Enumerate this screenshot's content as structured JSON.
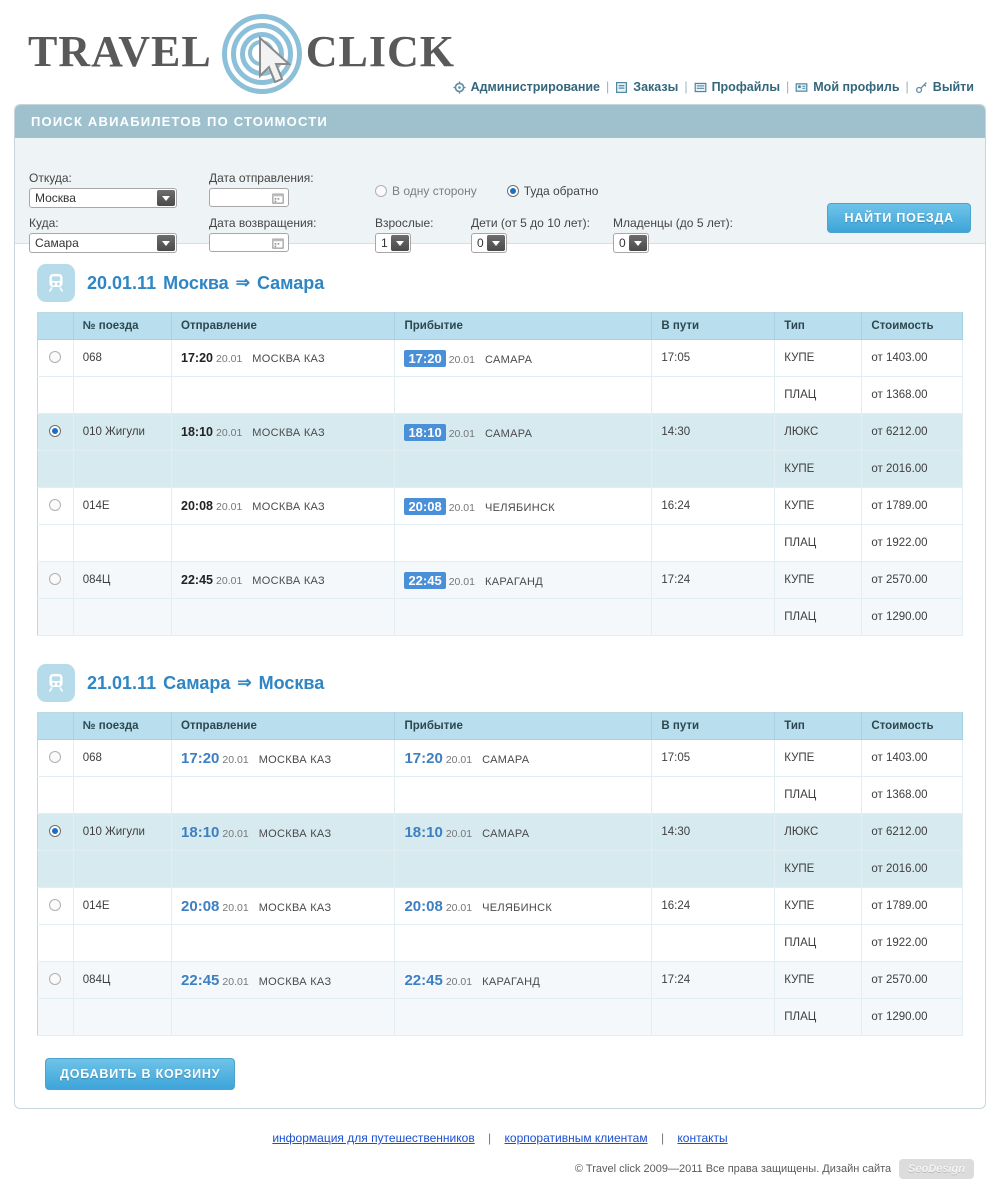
{
  "brand": {
    "word1": "TRAVEL",
    "word2": "CLICK"
  },
  "topnav": {
    "items": [
      {
        "label": "Администрирование",
        "icon": "gear-icon"
      },
      {
        "label": "Заказы",
        "icon": "orders-icon"
      },
      {
        "label": "Профайлы",
        "icon": "profiles-icon"
      },
      {
        "label": "Мой профиль",
        "icon": "my-profile-icon"
      },
      {
        "label": "Выйти",
        "icon": "key-icon"
      }
    ],
    "separator": "|"
  },
  "search": {
    "panel_title": "ПОИСК АВИАБИЛЕТОВ ПО СТОИМОСТИ",
    "from_label": "Откуда:",
    "from_value": "Москва",
    "to_label": "Куда:",
    "to_value": "Самара",
    "dep_date_label": "Дата отправления:",
    "dep_date_value": "",
    "ret_date_label": "Дата возвращения:",
    "ret_date_value": "",
    "trip_oneway": "В одну сторону",
    "trip_return": "Туда обратно",
    "adults_label": "Взрослые:",
    "adults_value": "1",
    "children_label": "Дети (от 5 до 10 лет):",
    "children_value": "0",
    "infants_label": "Младенцы (до 5 лет):",
    "infants_value": "0",
    "submit_label": "НАЙТИ ПОЕЗДА"
  },
  "table_headers": {
    "radio": "",
    "number": "№ поезда",
    "departure": "Отправление",
    "arrival": "Прибытие",
    "duration": "В пути",
    "type": "Тип",
    "price": "Стоимость"
  },
  "outbound": {
    "date": "20.01.11",
    "from": "Москва",
    "to": "Самара",
    "arrow": "⇒",
    "rows": [
      {
        "selected": false,
        "number": "068",
        "dep_time": "17:20",
        "dep_date": "20.01",
        "dep_station": "МОСКВА КАЗ",
        "arr_time": "17:20",
        "arr_date": "20.01",
        "arr_station": "САМАРА",
        "duration": "17:05",
        "fares": [
          {
            "type": "КУПЕ",
            "price": "от 1403.00"
          },
          {
            "type": "ПЛАЦ",
            "price": "от 1368.00"
          }
        ]
      },
      {
        "selected": true,
        "number": "010 Жигули",
        "dep_time": "18:10",
        "dep_date": "20.01",
        "dep_station": "МОСКВА КАЗ",
        "arr_time": "18:10",
        "arr_date": "20.01",
        "arr_station": "САМАРА",
        "duration": "14:30",
        "fares": [
          {
            "type": "ЛЮКС",
            "price": "от 6212.00"
          },
          {
            "type": "КУПЕ",
            "price": "от 2016.00"
          }
        ]
      },
      {
        "selected": false,
        "number": "014Е",
        "dep_time": "20:08",
        "dep_date": "20.01",
        "dep_station": "МОСКВА КАЗ",
        "arr_time": "20:08",
        "arr_date": "20.01",
        "arr_station": "ЧЕЛЯБИНСК",
        "duration": "16:24",
        "fares": [
          {
            "type": "КУПЕ",
            "price": "от 1789.00"
          },
          {
            "type": "ПЛАЦ",
            "price": "от 1922.00"
          }
        ]
      },
      {
        "selected": false,
        "number": "084Ц",
        "dep_time": "22:45",
        "dep_date": "20.01",
        "dep_station": "МОСКВА КАЗ",
        "arr_time": "22:45",
        "arr_date": "20.01",
        "arr_station": "КАРАГАНД",
        "duration": "17:24",
        "fares": [
          {
            "type": "КУПЕ",
            "price": "от 2570.00"
          },
          {
            "type": "ПЛАЦ",
            "price": "от 1290.00"
          }
        ]
      }
    ]
  },
  "inbound": {
    "date": "21.01.11",
    "from": "Самара",
    "to": "Москва",
    "arrow": "⇒",
    "rows": [
      {
        "selected": false,
        "number": "068",
        "dep_time": "17:20",
        "dep_date": "20.01",
        "dep_station": "МОСКВА КАЗ",
        "arr_time": "17:20",
        "arr_date": "20.01",
        "arr_station": "САМАРА",
        "duration": "17:05",
        "fares": [
          {
            "type": "КУПЕ",
            "price": "от 1403.00"
          },
          {
            "type": "ПЛАЦ",
            "price": "от 1368.00"
          }
        ]
      },
      {
        "selected": true,
        "number": "010 Жигули",
        "dep_time": "18:10",
        "dep_date": "20.01",
        "dep_station": "МОСКВА КАЗ",
        "arr_time": "18:10",
        "arr_date": "20.01",
        "arr_station": "САМАРА",
        "duration": "14:30",
        "fares": [
          {
            "type": "ЛЮКС",
            "price": "от 6212.00"
          },
          {
            "type": "КУПЕ",
            "price": "от 2016.00"
          }
        ]
      },
      {
        "selected": false,
        "number": "014Е",
        "dep_time": "20:08",
        "dep_date": "20.01",
        "dep_station": "МОСКВА КАЗ",
        "arr_time": "20:08",
        "arr_date": "20.01",
        "arr_station": "ЧЕЛЯБИНСК",
        "duration": "16:24",
        "fares": [
          {
            "type": "КУПЕ",
            "price": "от 1789.00"
          },
          {
            "type": "ПЛАЦ",
            "price": "от 1922.00"
          }
        ]
      },
      {
        "selected": false,
        "number": "084Ц",
        "dep_time": "22:45",
        "dep_date": "20.01",
        "dep_station": "МОСКВА КАЗ",
        "arr_time": "22:45",
        "arr_date": "20.01",
        "arr_station": "КАРАГАНД",
        "duration": "17:24",
        "fares": [
          {
            "type": "КУПЕ",
            "price": "от 2570.00"
          },
          {
            "type": "ПЛАЦ",
            "price": "от 1290.00"
          }
        ]
      }
    ]
  },
  "cart": {
    "add_label": "ДОБАВИТЬ В КОРЗИНУ"
  },
  "footer": {
    "links": [
      "информация для путешественников",
      "корпоративным клиентам",
      "контакты"
    ],
    "separator": "|",
    "copyright": "© Travel click  2009—2011  Все права защищены.   Дизайн сайта",
    "designer": "SeoDesign"
  },
  "colors": {
    "accent_blue": "#3da5d9",
    "panel_header": "#9fc1ce",
    "table_header": "#b9dfee",
    "highlight": "#4a90d9",
    "selected_row": "#d7eaf0",
    "link": "#1a4fd0"
  }
}
